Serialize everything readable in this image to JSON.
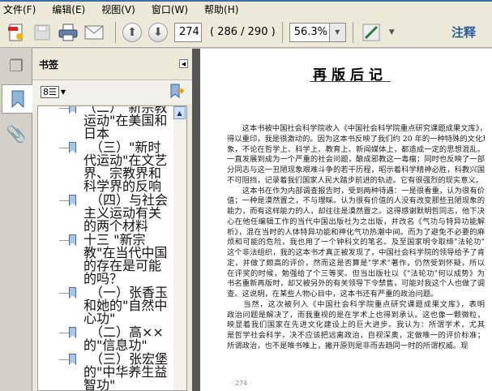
{
  "menu": [
    "文件(F)",
    "编辑(E)",
    "视图(V)",
    "窗口(W)",
    "帮助(H)"
  ],
  "toolbar": {
    "page_input": "274",
    "page_info": "( 286 / 290 )",
    "zoom": "56.3%",
    "comment": "注释"
  },
  "bookmarks": {
    "title": "书签",
    "items": [
      "（二）\"新宗教运动\"在美国和日本",
      "　（三）\"新时代运动\"在文艺界、宗教界和科学界的反响",
      "　（四）与社会主义运动有关的两个材料",
      "十三 \"新宗教\"在当代中国的存在是可能的吗？",
      "　（一）张香玉和她的\"自然中心功\"",
      "　（二）高××的\"信息功\"",
      "　（三）张宏堡的\"中华养生益智功\""
    ]
  },
  "document": {
    "title": "再版后记",
    "lines": [
      "　　这本书被中国社会科学院收入《中国社会科学院重点研究课题成果文库》，",
      "得以重印，我是很激动的。因为这本书反映了我们约 20 年的一种特殊的文化现",
      "象，不论在哲学上、科学上、教育上、新闻媒体上，都造成一定的思想混乱。",
      "一直发展到成为一个严重的社会问题，酿成邪教这一毒瘤；同时也反映了一部",
      "分同志与这一丑陋现象艰难斗争的若干历程，昭示着科学精神必胜，科教兴国",
      "不可阻挡，记录着我们国家人民大踏步前进的轨迹。它有很强烈的现实意义。",
      "　　这本书在作为内部调查报告时，受到两种待遇：一是很看重，认为很有价",
      "值；一种是漠然置之，不与理睬。认为很有价值的人没有改变那些丑陋现象的",
      "能力，而有这样能力的人，却往往是漠然置之。这得感谢默明哲同志，他下决",
      "心在他任编辑工作的当代中国出版社为之出版，并改名《气功与特异功能解",
      "析》，混在当时的人体特异功能和神化气功热潮中间。而为了避免不必要的麻",
      "烦和可能的危险，我也用了一个钟科文的笔名。及至国家明令取缔\"法轮功\"",
      "这个非法组织，我的这本书才真正被发现了，中国社会科学院的领导给予了肯",
      "定，并做了颇高的评价，然而这是否算是\"学术\"著作，仍然受到怀疑，所以",
      "在评奖的时候，勉强给了个三等奖。但当出版社以《\"法轮功\"何以成势》为",
      "书名重新再版时，却又被另外的有关领导下令禁售，可能对我这个人也做了调",
      "查。这说明，在某些人物心目中，这本书还有严重的政治问题。",
      "　　当然，这次被列入《中国社会科学院重点研究课题成果文库》，表明",
      "政治问题是解决了，而我重视的是在学术上也得到承认。这也像一颗微粒，",
      "映显着我们国家在先进文化建设上的巨大进步。我认为：所谓学术，尤其",
      "是哲学社会科学，决不应该把远离政治，自视深奥，定做唯一的评价标准；",
      "所谓政治，也不是唯书唯上，撇开原则是非而去趋同一时的所谓权威。现"
    ],
    "page_number": "· 274 ·"
  }
}
